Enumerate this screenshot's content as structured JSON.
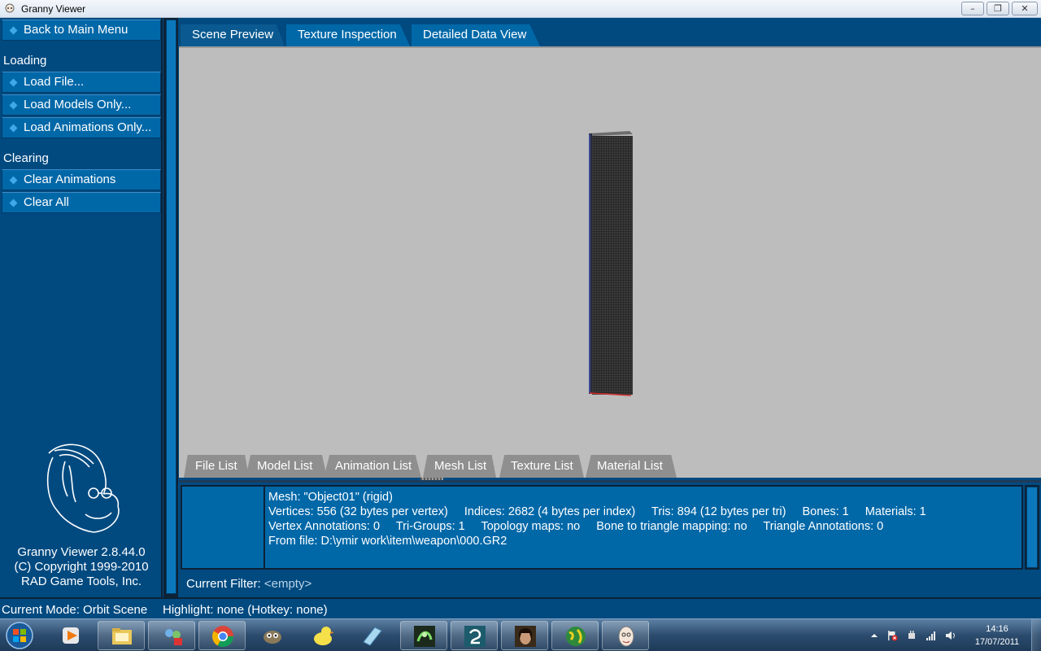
{
  "window": {
    "title": "Granny Viewer",
    "controls": {
      "minimize": "–",
      "maximize": "❐",
      "close": "✕"
    }
  },
  "sidebar": {
    "back_label": "Back to Main Menu",
    "sections": [
      {
        "title": "Loading",
        "items": [
          "Load File...",
          "Load Models Only...",
          "Load Animations Only..."
        ]
      },
      {
        "title": "Clearing",
        "items": [
          "Clear Animations",
          "Clear All"
        ]
      }
    ],
    "credits": [
      "Granny Viewer 2.8.44.0",
      "(C) Copyright 1999-2010",
      "RAD Game Tools, Inc."
    ]
  },
  "top_tabs": [
    "Scene Preview",
    "Texture Inspection",
    "Detailed Data View"
  ],
  "bottom_tabs": [
    "File List",
    "Model List",
    "Animation List",
    "Mesh List",
    "Texture List",
    "Material List"
  ],
  "info": {
    "line1": "Mesh: \"Object01\" (rigid)",
    "line2": [
      "Vertices: 556 (32 bytes per vertex)",
      "Indices: 2682 (4 bytes per index)",
      "Tris: 894 (12 bytes per tri)",
      "Bones: 1",
      "Materials: 1"
    ],
    "line3": [
      "Vertex Annotations: 0",
      "Tri-Groups: 1",
      "Topology maps: no",
      "Bone to triangle mapping: no",
      "Triangle Annotations: 0"
    ],
    "line4": "From file: D:\\ymir work\\item\\weapon\\000.GR2"
  },
  "filter": {
    "label": "Current Filter:",
    "value": "<empty>"
  },
  "status": {
    "mode": "Current Mode: Orbit Scene",
    "highlight": "Highlight: none (Hotkey: none)"
  },
  "taskbar": {
    "apps": [
      "windows-media-player",
      "windows-explorer",
      "messenger",
      "google-chrome",
      "gimp",
      "duck-app",
      "notepad-app",
      "3d-app",
      "3ds-max",
      "game-portrait",
      "globe-app",
      "granny-viewer"
    ],
    "clock_time": "14:16",
    "clock_date": "17/07/2011"
  },
  "colors": {
    "panel": "#004a80",
    "button": "#0168a8",
    "viewport": "#bdbdbd",
    "tab_inactive": "#8f8f8f"
  }
}
